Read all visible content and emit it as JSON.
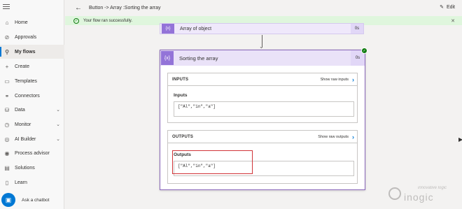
{
  "header": {
    "breadcrumb": "Button -> Array :Sorting the array",
    "edit_label": "Edit"
  },
  "banner": {
    "message": "Your flow ran successfully."
  },
  "sidebar": {
    "items": [
      {
        "label": "Home",
        "icon": "home-icon",
        "glyph": "⌂"
      },
      {
        "label": "Approvals",
        "icon": "approvals-icon",
        "glyph": "⊘"
      },
      {
        "label": "My flows",
        "icon": "flows-icon",
        "glyph": "⚲"
      },
      {
        "label": "Create",
        "icon": "plus-icon",
        "glyph": "+"
      },
      {
        "label": "Templates",
        "icon": "templates-icon",
        "glyph": "▭"
      },
      {
        "label": "Connectors",
        "icon": "connectors-icon",
        "glyph": "⚭"
      },
      {
        "label": "Data",
        "icon": "data-icon",
        "glyph": "⛁"
      },
      {
        "label": "Monitor",
        "icon": "monitor-icon",
        "glyph": "◷"
      },
      {
        "label": "AI Builder",
        "icon": "ai-builder-icon",
        "glyph": "◎"
      },
      {
        "label": "Process advisor",
        "icon": "process-advisor-icon",
        "glyph": "◉"
      },
      {
        "label": "Solutions",
        "icon": "solutions-icon",
        "glyph": "▤"
      },
      {
        "label": "Learn",
        "icon": "learn-icon",
        "glyph": "▯"
      }
    ],
    "chatbot_label": "Ask a chatbot"
  },
  "flow": {
    "previous_step": {
      "title": "Array of object",
      "duration": "0s"
    },
    "current_step": {
      "title": "Sorting the array",
      "duration": "0s"
    },
    "op_icon_glyph": "{x}",
    "inputs": {
      "section_label": "INPUTS",
      "show_raw_label": "Show raw inputs",
      "field_label": "Inputs",
      "value": "[\"Al\",\"in\",\"a\"]"
    },
    "outputs": {
      "section_label": "OUTPUTS",
      "show_raw_label": "Show raw outputs",
      "field_label": "Outputs",
      "value": "[\"Al\",\"in\",\"a\"]"
    }
  },
  "watermark": {
    "tagline": "innovative logic",
    "brand": "inogic"
  },
  "colors": {
    "accent": "#0078d4",
    "operation_purple": "#9373d8",
    "success_green": "#107c10",
    "highlight_red": "#d13438"
  }
}
